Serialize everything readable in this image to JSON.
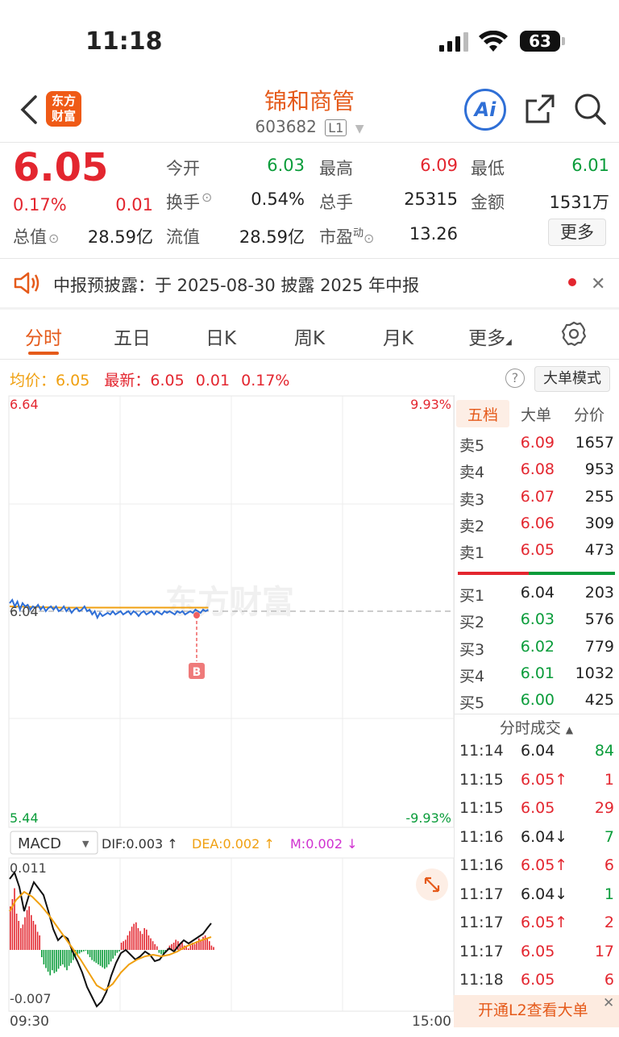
{
  "status_bar": {
    "time": "11:18",
    "battery": "63"
  },
  "header": {
    "title": "锦和商管",
    "code": "603682",
    "level_badge": "L1",
    "logo_text_1": "东方",
    "logo_text_2": "财富"
  },
  "quote": {
    "price": "6.05",
    "change_pct": "0.17%",
    "change": "0.01",
    "open_label": "今开",
    "open": "6.03",
    "high_label": "最高",
    "high": "6.09",
    "low_label": "最低",
    "low": "6.01",
    "turnover_label": "换手",
    "turnover": "0.54%",
    "volume_label": "总手",
    "volume": "25315",
    "amount_label": "金额",
    "amount": "1531万",
    "mktcap_label": "总值",
    "mktcap": "28.59亿",
    "float_label": "流值",
    "float": "28.59亿",
    "pe_label": "市盈",
    "pe_sup": "动",
    "pe": "13.26",
    "more_label": "更多"
  },
  "notice": {
    "text": "中报预披露：于 2025-08-30 披露 2025 年中报"
  },
  "tabs": [
    "分时",
    "五日",
    "日K",
    "周K",
    "月K",
    "更多"
  ],
  "info": {
    "avg_label": "均价：",
    "avg": "6.05",
    "latest_label": "最新：",
    "latest": "6.05",
    "change": "0.01",
    "change_pct": "0.17%",
    "mode_button": "大单模式"
  },
  "chart_labels": {
    "top_price": "6.64",
    "top_pct": "9.93%",
    "mid_price": "6.04",
    "bottom_price": "5.44",
    "bottom_pct": "-9.93%",
    "marker": "B",
    "macd_select": "MACD",
    "dif": "DIF:0.003 ↑",
    "dea": "DEA:0.002 ↑",
    "m": "M:0.002 ↓",
    "macd_top": "0.011",
    "macd_bottom": "-0.007",
    "time_start": "09:30",
    "time_end": "15:00",
    "watermark": "东方财富"
  },
  "order_book": {
    "tabs": [
      "五档",
      "大单",
      "分价"
    ],
    "asks": [
      {
        "label": "卖5",
        "price": "6.09",
        "vol": "1657"
      },
      {
        "label": "卖4",
        "price": "6.08",
        "vol": "953"
      },
      {
        "label": "卖3",
        "price": "6.07",
        "vol": "255"
      },
      {
        "label": "卖2",
        "price": "6.06",
        "vol": "309"
      },
      {
        "label": "卖1",
        "price": "6.05",
        "vol": "473"
      }
    ],
    "bids": [
      {
        "label": "买1",
        "price": "6.04",
        "vol": "203"
      },
      {
        "label": "买2",
        "price": "6.03",
        "vol": "576"
      },
      {
        "label": "买3",
        "price": "6.02",
        "vol": "779"
      },
      {
        "label": "买4",
        "price": "6.01",
        "vol": "1032"
      },
      {
        "label": "买5",
        "price": "6.00",
        "vol": "425"
      }
    ],
    "trades_title": "分时成交",
    "trades": [
      {
        "time": "11:14",
        "price": "6.04",
        "vol": "84"
      },
      {
        "time": "11:15",
        "price": "6.05↑",
        "vol": "1"
      },
      {
        "time": "11:15",
        "price": "6.05",
        "vol": "29"
      },
      {
        "time": "11:16",
        "price": "6.04↓",
        "vol": "7"
      },
      {
        "time": "11:16",
        "price": "6.05↑",
        "vol": "6"
      },
      {
        "time": "11:17",
        "price": "6.04↓",
        "vol": "1"
      },
      {
        "time": "11:17",
        "price": "6.05↑",
        "vol": "2"
      },
      {
        "time": "11:17",
        "price": "6.05",
        "vol": "17"
      },
      {
        "time": "11:18",
        "price": "6.05",
        "vol": "6"
      }
    ],
    "l2_banner": "开通L2查看大单"
  },
  "colors": {
    "up": "#e3262f",
    "down": "#0a9c3a",
    "accent": "#e55a1a",
    "avg_line": "#f0a010",
    "price_line": "#2f6fd6"
  }
}
